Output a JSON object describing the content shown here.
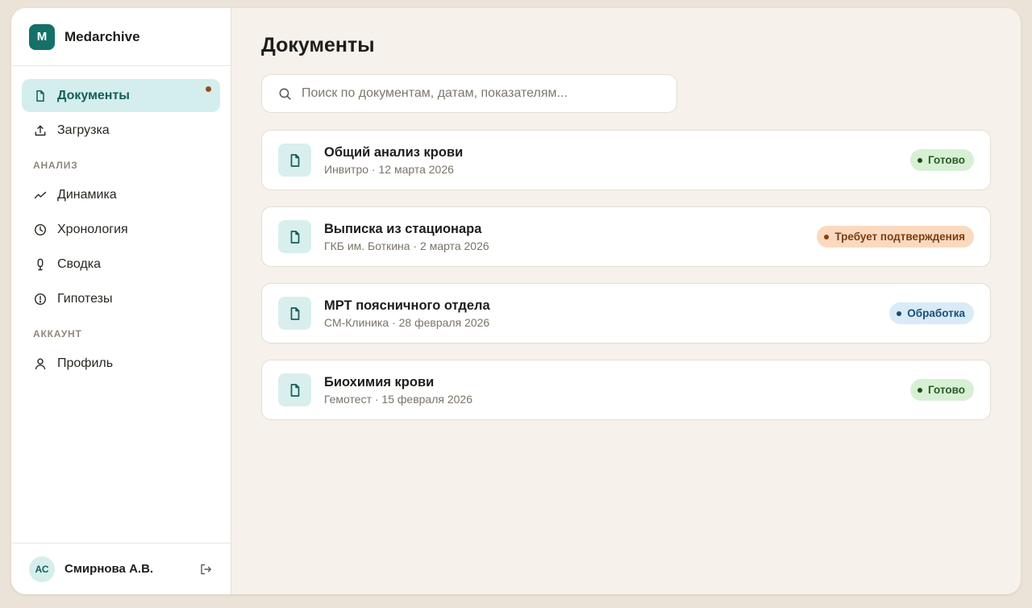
{
  "brand": {
    "logo_letter": "M",
    "name": "Medarchive",
    "accent": "#15706a"
  },
  "sidebar": {
    "items_main": [
      {
        "label": "Документы",
        "icon": "file-icon",
        "active": true,
        "has_dot": true
      },
      {
        "label": "Загрузка",
        "icon": "upload-icon",
        "active": false
      }
    ],
    "section_analysis": "АНАЛИЗ",
    "items_analysis": [
      {
        "label": "Динамика",
        "icon": "trend-icon"
      },
      {
        "label": "Хронология",
        "icon": "clock-icon"
      },
      {
        "label": "Сводка",
        "icon": "summary-icon"
      },
      {
        "label": "Гипотезы",
        "icon": "alert-circle-icon"
      }
    ],
    "section_account": "АККАУНТ",
    "items_account": [
      {
        "label": "Профиль",
        "icon": "user-icon"
      }
    ]
  },
  "user": {
    "initials": "АС",
    "name": "Смирнова А.В."
  },
  "main": {
    "title": "Документы",
    "search_placeholder": "Поиск по документам, датам, показателям..."
  },
  "documents": [
    {
      "title": "Общий анализ крови",
      "meta": "Инвитро · 12 марта 2026",
      "status": "Готово",
      "status_type": "ready"
    },
    {
      "title": "Выписка из стационара",
      "meta": "ГКБ им. Боткина · 2 марта 2026",
      "status": "Требует подтверждения",
      "status_type": "confirm"
    },
    {
      "title": "МРТ поясничного отдела",
      "meta": "СМ-Клиника · 28 февраля 2026",
      "status": "Обработка",
      "status_type": "processing"
    },
    {
      "title": "Биохимия крови",
      "meta": "Гемотест · 15 февраля 2026",
      "status": "Готово",
      "status_type": "ready"
    }
  ]
}
